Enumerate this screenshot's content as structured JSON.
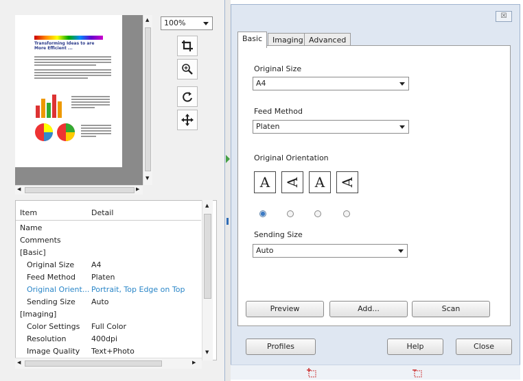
{
  "zoom": {
    "value": "100%"
  },
  "preview_page": {
    "heading_lines": [
      "Transforming Ideas to are",
      "More Efficient ..."
    ]
  },
  "detail_table": {
    "headers": {
      "item": "Item",
      "detail": "Detail"
    },
    "rows": [
      {
        "key": "Name",
        "value": "",
        "indent": false
      },
      {
        "key": "Comments",
        "value": "",
        "indent": false
      },
      {
        "key": "[Basic]",
        "value": "",
        "indent": false
      },
      {
        "key": "Original Size",
        "value": "A4",
        "indent": true
      },
      {
        "key": "Feed Method",
        "value": "Platen",
        "indent": true
      },
      {
        "key": "Original Orient...",
        "value": "Portrait, Top Edge on Top",
        "indent": true,
        "selected": true
      },
      {
        "key": "Sending Size",
        "value": "Auto",
        "indent": true
      },
      {
        "key": "[Imaging]",
        "value": "",
        "indent": false
      },
      {
        "key": "Color Settings",
        "value": "Full Color",
        "indent": true
      },
      {
        "key": "Resolution",
        "value": "400dpi",
        "indent": true
      },
      {
        "key": "Image Quality",
        "value": "Text+Photo",
        "indent": true
      }
    ]
  },
  "dialog": {
    "close_glyph": "☒",
    "tabs": [
      "Basic",
      "Imaging",
      "Advanced"
    ],
    "original_size": {
      "label": "Original Size",
      "value": "A4"
    },
    "feed_method": {
      "label": "Feed Method",
      "value": "Platen"
    },
    "original_orientation": {
      "label": "Original Orientation",
      "selected_index": 0
    },
    "sending_size": {
      "label": "Sending Size",
      "value": "Auto"
    },
    "buttons": {
      "preview": "Preview",
      "add": "Add...",
      "scan": "Scan"
    },
    "footer": {
      "profiles": "Profiles",
      "help": "Help",
      "close": "Close"
    }
  }
}
